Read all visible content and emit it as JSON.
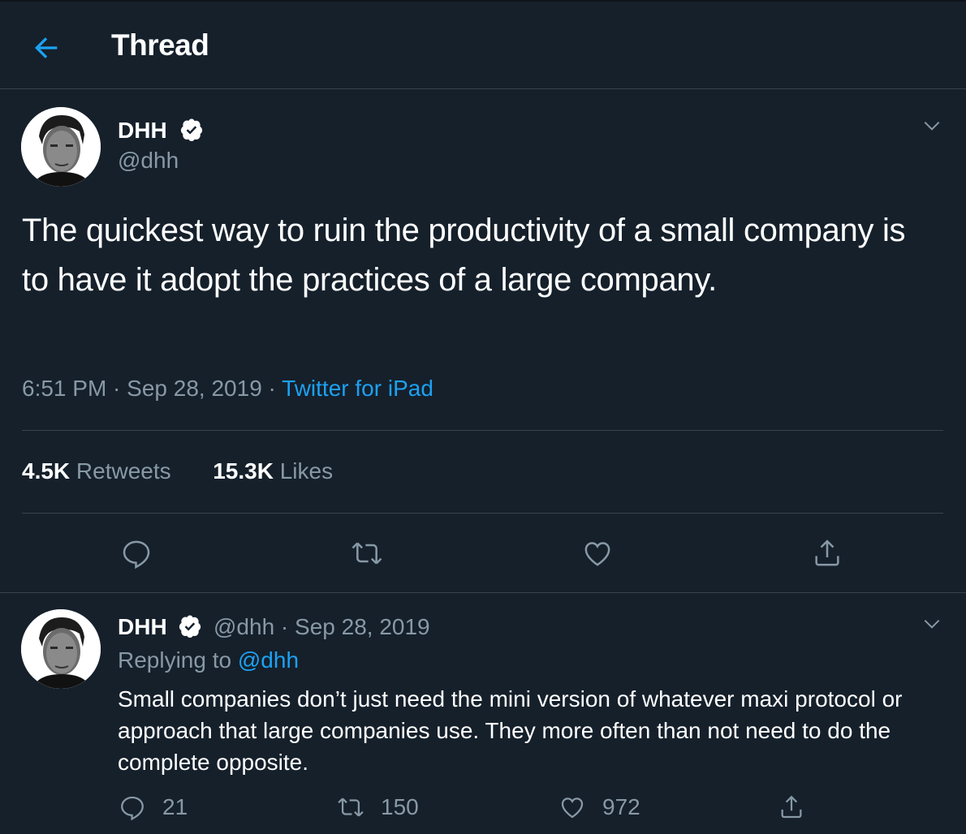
{
  "header": {
    "title": "Thread",
    "back_icon": "arrow-left-icon"
  },
  "colors": {
    "background": "#15202b",
    "accent": "#1da1f2",
    "muted": "#8899a6",
    "divider": "#38444d"
  },
  "main_tweet": {
    "author_name": "DHH",
    "handle": "@dhh",
    "text": "The quickest way to ruin the productivity of a small company is to have it adopt the practices of a large company.",
    "time": "6:51 PM",
    "date": "Sep 28, 2019",
    "separator": " · ",
    "source": "Twitter for iPad",
    "retweets_count": "4.5K",
    "retweets_label": " Retweets",
    "likes_count": "15.3K",
    "likes_label": " Likes",
    "actions": [
      "reply-icon",
      "retweet-icon",
      "like-icon",
      "share-icon"
    ]
  },
  "reply_tweet": {
    "author_name": "DHH",
    "handle": "@dhh",
    "separator": " · ",
    "date": "Sep 28, 2019",
    "replying_prefix": "Replying to ",
    "replying_to": "@dhh",
    "text": "Small companies don’t just need the mini version of whatever maxi protocol or approach that large companies use. They more often than not need to do the complete opposite.",
    "reply_count": "21",
    "retweet_count": "150",
    "like_count": "972"
  }
}
